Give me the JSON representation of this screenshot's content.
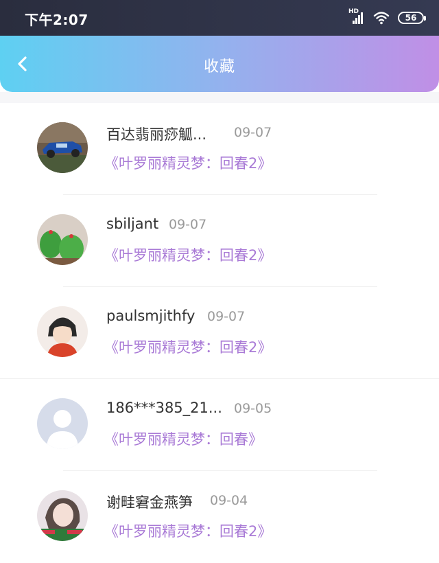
{
  "status_bar": {
    "time": "下午2:07",
    "battery": "56",
    "network_label": "HD"
  },
  "header": {
    "title": "收藏",
    "back_icon": "chevron-left-icon"
  },
  "favorites": [
    {
      "name": "百达翡丽痧觚...",
      "date": "09-07",
      "game": "《叶罗丽精灵梦：回春2》"
    },
    {
      "name": "sbiljant",
      "date": "09-07",
      "game": "《叶罗丽精灵梦：回春2》"
    },
    {
      "name": "paulsmjithfy",
      "date": "09-07",
      "game": "《叶罗丽精灵梦：回春2》"
    },
    {
      "name": "186***385_21...",
      "date": "09-05",
      "game": "《叶罗丽精灵梦：回春》"
    },
    {
      "name": "谢畦窘金燕笋",
      "date": "09-04",
      "game": "《叶罗丽精灵梦：回春2》"
    }
  ],
  "colors": {
    "accent_purple": "#a97ad6",
    "header_start": "#5ed0f2",
    "header_end": "#c08fe6"
  }
}
